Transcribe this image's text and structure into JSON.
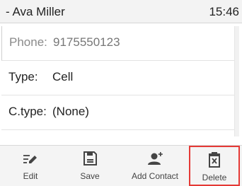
{
  "header": {
    "contact_name": "- Ava Miller",
    "time": "15:46"
  },
  "fields": [
    {
      "label": "Phone:",
      "value": "9175550123"
    },
    {
      "label": "Type:",
      "value": "Cell"
    },
    {
      "label": "C.type:",
      "value": "(None)"
    }
  ],
  "softkeys": [
    {
      "label": "Edit",
      "icon": "edit-icon"
    },
    {
      "label": "Save",
      "icon": "save-icon"
    },
    {
      "label": "Add Contact",
      "icon": "add-contact-icon"
    },
    {
      "label": "Delete",
      "icon": "delete-icon"
    }
  ],
  "colors": {
    "highlight": "#e53935",
    "softkey_bar": "#f4f4f4",
    "title_bar": "#f3f3f3"
  }
}
